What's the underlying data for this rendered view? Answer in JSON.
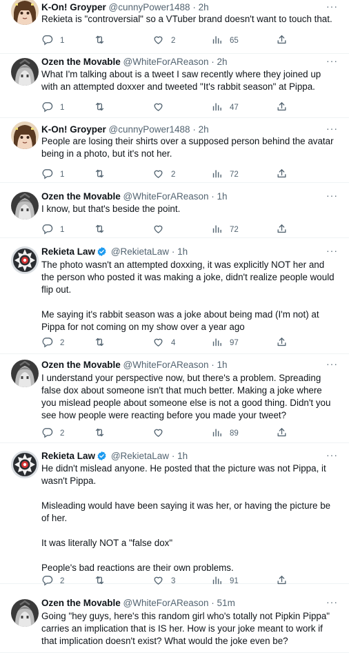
{
  "tweets": [
    {
      "author": "K-On! Groyper",
      "handle": "@cunnyPower1488",
      "time": "2h",
      "avatar": "groyper",
      "paragraphs": [
        "Rekieta is \"controversial\" so a VTuber brand doesn't want to touch that."
      ],
      "replies": "1",
      "retweets": "",
      "likes": "2",
      "views": "65"
    },
    {
      "author": "Ozen the Movable",
      "handle": "@WhiteForAReason",
      "time": "2h",
      "avatar": "ozen",
      "paragraphs": [
        "What I'm talking about is a tweet I saw recently where they joined up with an attempted doxxer and tweeted \"It's rabbit season\" at Pippa."
      ],
      "replies": "1",
      "retweets": "",
      "likes": "",
      "views": "47"
    },
    {
      "author": "K-On! Groyper",
      "handle": "@cunnyPower1488",
      "time": "2h",
      "avatar": "groyper",
      "paragraphs": [
        "People are losing their shirts over a supposed person behind the avatar being in a photo, but it's not her."
      ],
      "replies": "1",
      "retweets": "",
      "likes": "2",
      "views": "72"
    },
    {
      "author": "Ozen the Movable",
      "handle": "@WhiteForAReason",
      "time": "1h",
      "avatar": "ozen",
      "paragraphs": [
        "I know, but that's beside the point."
      ],
      "replies": "1",
      "retweets": "",
      "likes": "",
      "views": "72"
    },
    {
      "author": "Rekieta Law",
      "handle": "@RekietaLaw",
      "time": "1h",
      "avatar": "rekieta",
      "verified": true,
      "paragraphs": [
        "The photo wasn't an attempted doxxing, it was explicitly NOT her and the person who posted it was making a joke, didn't realize people would flip out.",
        "Me saying it's rabbit season was a joke about being mad (I'm not) at Pippa for not coming on my show over a year ago"
      ],
      "replies": "2",
      "retweets": "",
      "likes": "4",
      "views": "97"
    },
    {
      "author": "Ozen the Movable",
      "handle": "@WhiteForAReason",
      "time": "1h",
      "avatar": "ozen",
      "paragraphs": [
        "I understand your perspective now, but there's a problem. Spreading false dox about someone isn't that much better. Making a joke where you mislead people about someone else is not a good thing. Didn't you see how people were reacting before you made your tweet?"
      ],
      "replies": "2",
      "retweets": "",
      "likes": "",
      "views": "89"
    },
    {
      "author": "Rekieta Law",
      "handle": "@RekietaLaw",
      "time": "1h",
      "avatar": "rekieta",
      "verified": true,
      "paragraphs": [
        "He didn't mislead anyone.  He posted that the picture was not Pippa, it wasn't Pippa.",
        "Misleading would have been saying it was her, or having the picture be of her.",
        "It was literally NOT a \"false dox\"",
        "People's bad reactions are their own problems."
      ],
      "replies": "2",
      "retweets": "",
      "likes": "3",
      "views": "91"
    },
    {
      "author": "Ozen the Movable",
      "handle": "@WhiteForAReason",
      "time": "51m",
      "avatar": "ozen",
      "paragraphs": [
        "Going \"hey guys, here's this random girl who's totally not Pipkin Pippa\" carries an implication that is IS her. How is your joke meant to work if that implication doesn't exist? What would the joke even be?"
      ],
      "replies": "",
      "retweets": "",
      "likes": "",
      "views": ""
    }
  ],
  "colors": {
    "text": "#0f1419",
    "muted": "#536471",
    "verified": "#1d9bf0",
    "divider": "#eff3f4"
  },
  "icons": {
    "reply": "reply-icon",
    "retweet": "retweet-icon",
    "like": "heart-icon",
    "views": "views-icon",
    "share": "share-icon",
    "more": "more-icon",
    "verified": "verified-badge-icon"
  }
}
